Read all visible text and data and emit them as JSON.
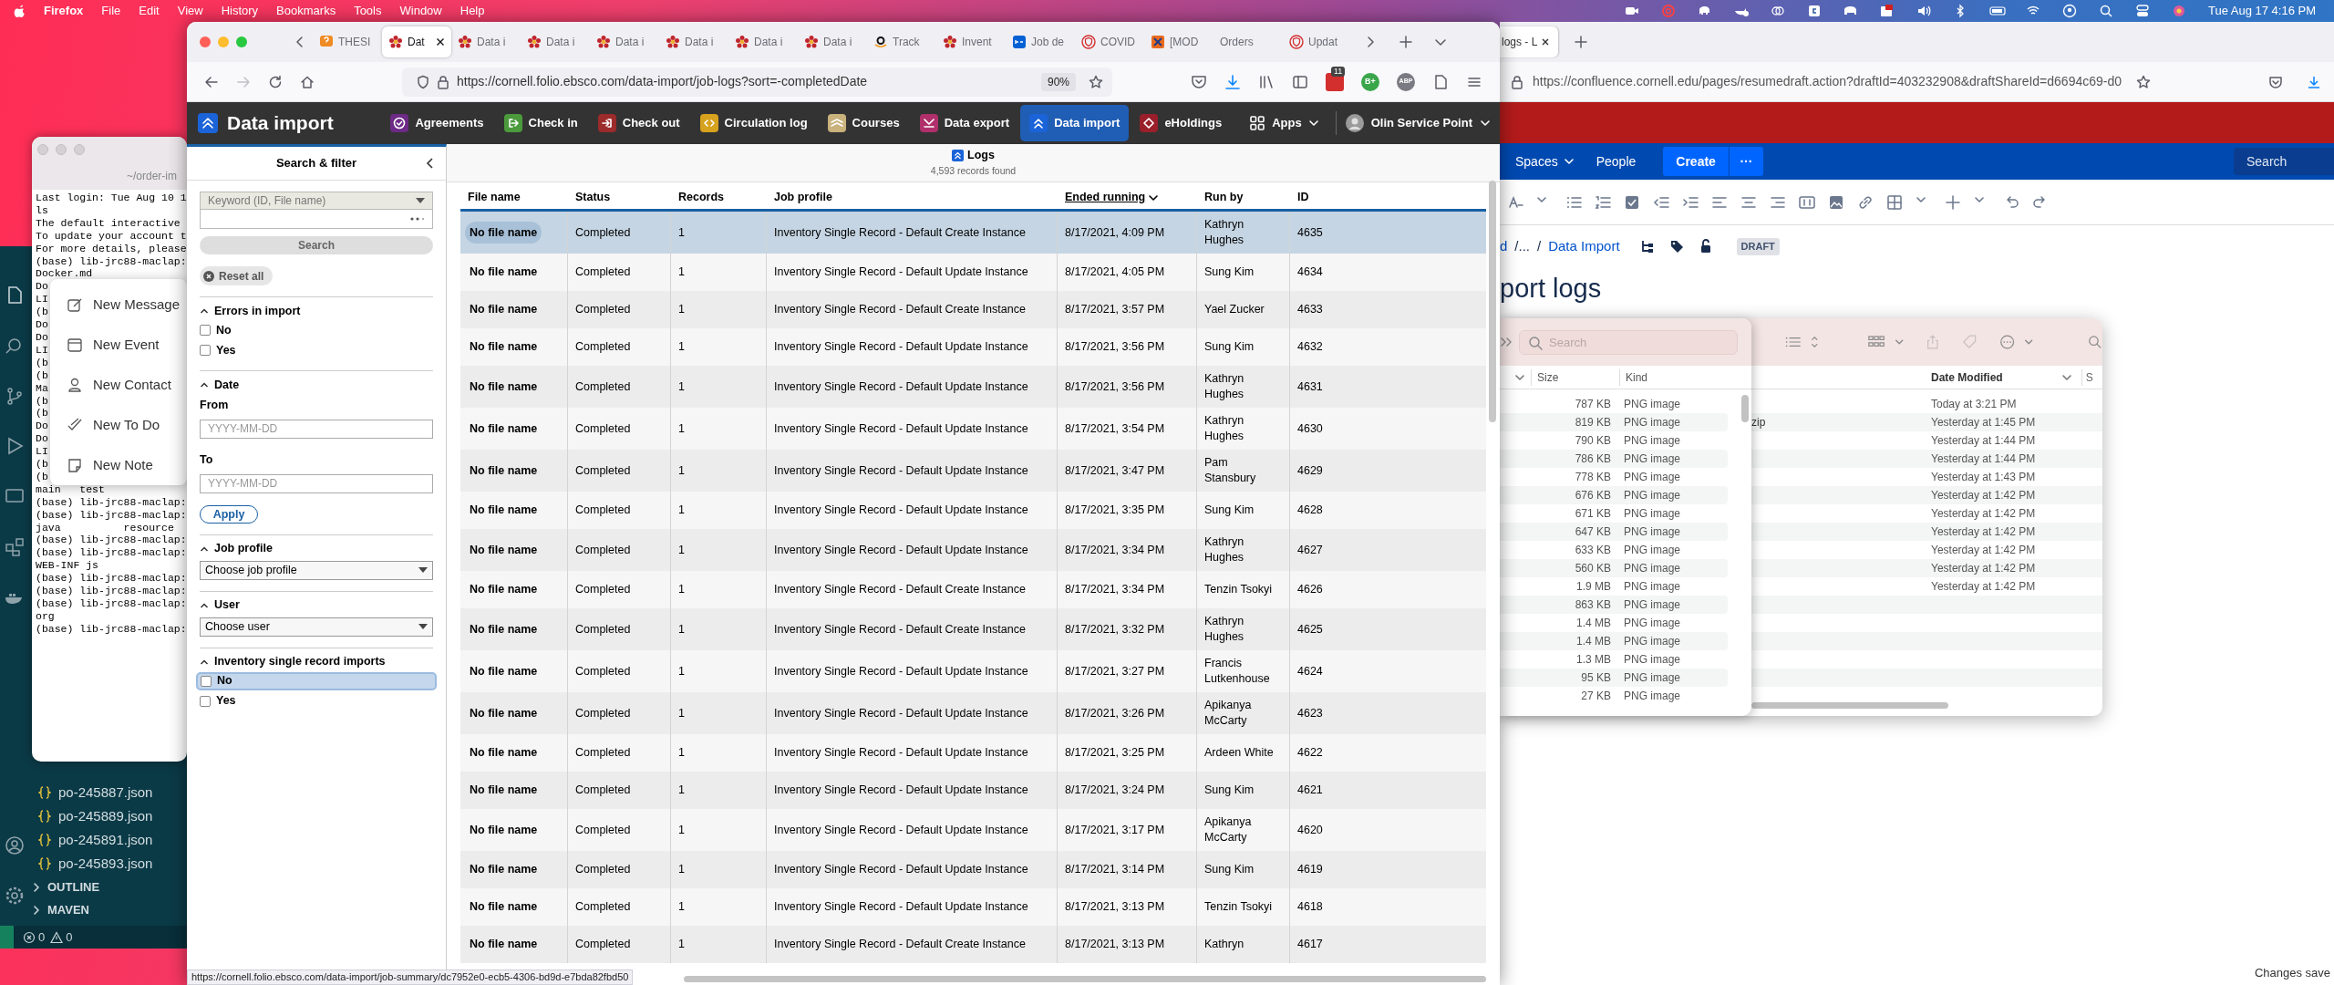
{
  "menu_bar": {
    "menus": [
      "Firefox",
      "File",
      "Edit",
      "View",
      "History",
      "Bookmarks",
      "Tools",
      "Window",
      "Help"
    ],
    "clock": "Tue Aug 17 4:16 PM"
  },
  "vscode": {
    "files": [
      "po-245887.json",
      "po-245889.json",
      "po-245891.json",
      "po-245893.json"
    ],
    "sections": [
      "OUTLINE",
      "MAVEN"
    ],
    "errors": "0",
    "warnings": "0"
  },
  "terminal": {
    "title": "~/order-im",
    "lines": [
      "Last login: Tue Aug 10 1",
      "ls",
      "The default interactive",
      "To update your account t",
      "For more details, please",
      "(base) lib-jrc88-maclap:",
      "Docker.md",
      "Do",
      "LI",
      "(b",
      "Do",
      "Do",
      "LI",
      "(b",
      "(b",
      "Ma",
      "(b",
      "(b",
      "Do",
      "Do",
      "LI",
      "(b",
      "(b",
      "main   test",
      "(base) lib-jrc88-maclap:",
      "(base) lib-jrc88-maclap:",
      "java          resource",
      "(base) lib-jrc88-maclap:",
      "(base) lib-jrc88-maclap:",
      "WEB-INF js",
      "(base) lib-jrc88-maclap:",
      "(base) lib-jrc88-maclap:",
      "(base) lib-jrc88-maclap:",
      "org",
      "(base) lib-jrc88-maclap:"
    ]
  },
  "new_item_menu": {
    "items": [
      {
        "kind": "message",
        "label": "New Message"
      },
      {
        "kind": "event",
        "label": "New Event"
      },
      {
        "kind": "contact",
        "label": "New Contact"
      },
      {
        "kind": "todo",
        "label": "New To Do"
      },
      {
        "kind": "note",
        "label": "New Note"
      }
    ]
  },
  "confluence_window": {
    "tab": "logs - L",
    "url": "https://confluence.cornell.edu/pages/resumedraft.action?draftId=403232908&draftShareId=d6694c69-d0",
    "nav": {
      "spaces": "Spaces",
      "people": "People",
      "create": "Create",
      "more": "···",
      "search_placeholder": "Search"
    },
    "breadcrumb": {
      "start": "d",
      "ellipsis": "/...",
      "separator": "/",
      "link": "Data Import",
      "badge": "DRAFT"
    },
    "title": "port logs",
    "footer": "Changes save"
  },
  "finder": {
    "search_placeholder": "Search",
    "columns": {
      "size": "Size",
      "kind": "Kind",
      "date": "Date Modified",
      "cut": "S"
    },
    "rows": [
      {
        "size": "787 KB",
        "kind": "PNG image",
        "date": "Today at 3:21 PM"
      },
      {
        "size": "819 KB",
        "kind": "PNG image",
        "name": "zip",
        "date": "Yesterday at 1:45 PM"
      },
      {
        "size": "790 KB",
        "kind": "PNG image",
        "date": "Yesterday at 1:44 PM"
      },
      {
        "size": "786 KB",
        "kind": "PNG image",
        "date": "Yesterday at 1:44 PM"
      },
      {
        "size": "778 KB",
        "kind": "PNG image",
        "date": "Yesterday at 1:43 PM"
      },
      {
        "size": "676 KB",
        "kind": "PNG image",
        "date": "Yesterday at 1:42 PM"
      },
      {
        "size": "671 KB",
        "kind": "PNG image",
        "date": "Yesterday at 1:42 PM"
      },
      {
        "size": "647 KB",
        "kind": "PNG image",
        "date": "Yesterday at 1:42 PM"
      },
      {
        "size": "633 KB",
        "kind": "PNG image",
        "date": "Yesterday at 1:42 PM"
      },
      {
        "size": "560 KB",
        "kind": "PNG image",
        "date": "Yesterday at 1:42 PM"
      },
      {
        "size": "1.9 MB",
        "kind": "PNG image",
        "date": "Yesterday at 1:42 PM"
      },
      {
        "size": "863 KB",
        "kind": "PNG image"
      },
      {
        "size": "1.4 MB",
        "kind": "PNG image"
      },
      {
        "size": "1.4 MB",
        "kind": "PNG image"
      },
      {
        "size": "1.3 MB",
        "kind": "PNG image"
      },
      {
        "size": "95 KB",
        "kind": "PNG image"
      },
      {
        "size": "27 KB",
        "kind": "PNG image"
      }
    ]
  },
  "browser": {
    "tabs": [
      {
        "title": "THESI",
        "kind": "question",
        "selected": false
      },
      {
        "title": "Dat",
        "kind": "folio",
        "selected": true
      },
      {
        "title": "Data i",
        "kind": "folio",
        "selected": false
      },
      {
        "title": "Data i",
        "kind": "folio",
        "selected": false
      },
      {
        "title": "Data i",
        "kind": "folio",
        "selected": false
      },
      {
        "title": "Data i",
        "kind": "folio",
        "selected": false
      },
      {
        "title": "Data i",
        "kind": "folio",
        "selected": false
      },
      {
        "title": "Data i",
        "kind": "folio",
        "selected": false
      },
      {
        "title": "Track",
        "kind": "amazon",
        "selected": false
      },
      {
        "title": "Invent",
        "kind": "folio",
        "selected": false
      },
      {
        "title": "Job de",
        "kind": "box",
        "selected": false
      },
      {
        "title": "COVID",
        "kind": "shield",
        "selected": false
      },
      {
        "title": "[MOD",
        "kind": "module",
        "selected": false
      },
      {
        "title": "Orders",
        "kind": "plain",
        "selected": false
      },
      {
        "title": "Updat",
        "kind": "shield",
        "selected": false
      }
    ],
    "forward_disabled": true,
    "url": "https://cornell.folio.ebsco.com/data-import/job-logs?sort=-completedDate",
    "zoom": "90%",
    "extension_badge": "11",
    "grade_extension": "B+",
    "adblock_extension": "ABP"
  },
  "folio": {
    "app_title": "Data import",
    "apps": [
      {
        "label": "Agreements",
        "color": "#6d2a86",
        "selected": false
      },
      {
        "label": "Check in",
        "color": "#4b9a3c",
        "selected": false
      },
      {
        "label": "Check out",
        "color": "#9c2b2b",
        "selected": false
      },
      {
        "label": "Circulation log",
        "color": "#d7a21e",
        "selected": false
      },
      {
        "label": "Courses",
        "color": "#c9b27c",
        "selected": false
      },
      {
        "label": "Data export",
        "color": "#b02f6b",
        "selected": false
      },
      {
        "label": "Data import",
        "color": "#1a63d8",
        "selected": true
      },
      {
        "label": "eHoldings",
        "color": "#9a1f2b",
        "selected": false
      }
    ],
    "apps_menu": "Apps",
    "service_point": "Olin Service Point"
  },
  "filters": {
    "title": "Search & filter",
    "keyword_option": "Keyword (ID, File name)",
    "search_button": "Search",
    "reset_button": "Reset all",
    "sections": [
      {
        "kind": "checkboxes",
        "title": "Errors in import",
        "expanded": true,
        "options": [
          {
            "label": "No",
            "checked": false,
            "focused": false
          },
          {
            "label": "Yes",
            "checked": false,
            "focused": false
          }
        ]
      },
      {
        "kind": "date",
        "title": "Date",
        "expanded": true,
        "from_label": "From",
        "from_placeholder": "YYYY-MM-DD",
        "to_label": "To",
        "to_placeholder": "YYYY-MM-DD",
        "apply": "Apply"
      },
      {
        "kind": "select",
        "title": "Job profile",
        "expanded": true,
        "value": "Choose job profile"
      },
      {
        "kind": "select",
        "title": "User",
        "expanded": true,
        "value": "Choose user"
      },
      {
        "kind": "checkboxes",
        "title": "Inventory single record imports",
        "expanded": true,
        "options": [
          {
            "label": "No",
            "checked": false,
            "focused": true
          },
          {
            "label": "Yes",
            "checked": false,
            "focused": false
          }
        ]
      }
    ]
  },
  "logs": {
    "title": "Logs",
    "count": "4,593 records found",
    "columns": [
      {
        "label": "File name",
        "sorted": false
      },
      {
        "label": "Status",
        "sorted": false
      },
      {
        "label": "Records",
        "sorted": false
      },
      {
        "label": "Job profile",
        "sorted": false
      },
      {
        "label": "Ended running",
        "sorted": true
      },
      {
        "label": "Run by",
        "sorted": false
      },
      {
        "label": "ID",
        "sorted": false
      }
    ],
    "rows": [
      {
        "file": "No file name",
        "status": "Completed",
        "records": "1",
        "profile": "Inventory Single Record - Default Create Instance",
        "ended": "8/17/2021, 4:09 PM",
        "run_by": "Kathryn Hughes",
        "id": "4635",
        "selected": true
      },
      {
        "file": "No file name",
        "status": "Completed",
        "records": "1",
        "profile": "Inventory Single Record - Default Update Instance",
        "ended": "8/17/2021, 4:05 PM",
        "run_by": "Sung Kim",
        "id": "4634",
        "selected": false
      },
      {
        "file": "No file name",
        "status": "Completed",
        "records": "1",
        "profile": "Inventory Single Record - Default Create Instance",
        "ended": "8/17/2021, 3:57 PM",
        "run_by": "Yael Zucker",
        "id": "4633",
        "selected": false
      },
      {
        "file": "No file name",
        "status": "Completed",
        "records": "1",
        "profile": "Inventory Single Record - Default Update Instance",
        "ended": "8/17/2021, 3:56 PM",
        "run_by": "Sung Kim",
        "id": "4632",
        "selected": false
      },
      {
        "file": "No file name",
        "status": "Completed",
        "records": "1",
        "profile": "Inventory Single Record - Default Update Instance",
        "ended": "8/17/2021, 3:56 PM",
        "run_by": "Kathryn Hughes",
        "id": "4631",
        "selected": false
      },
      {
        "file": "No file name",
        "status": "Completed",
        "records": "1",
        "profile": "Inventory Single Record - Default Update Instance",
        "ended": "8/17/2021, 3:54 PM",
        "run_by": "Kathryn Hughes",
        "id": "4630",
        "selected": false
      },
      {
        "file": "No file name",
        "status": "Completed",
        "records": "1",
        "profile": "Inventory Single Record - Default Update Instance",
        "ended": "8/17/2021, 3:47 PM",
        "run_by": "Pam Stansbury",
        "id": "4629",
        "selected": false
      },
      {
        "file": "No file name",
        "status": "Completed",
        "records": "1",
        "profile": "Inventory Single Record - Default Update Instance",
        "ended": "8/17/2021, 3:35 PM",
        "run_by": "Sung Kim",
        "id": "4628",
        "selected": false
      },
      {
        "file": "No file name",
        "status": "Completed",
        "records": "1",
        "profile": "Inventory Single Record - Default Update Instance",
        "ended": "8/17/2021, 3:34 PM",
        "run_by": "Kathryn Hughes",
        "id": "4627",
        "selected": false
      },
      {
        "file": "No file name",
        "status": "Completed",
        "records": "1",
        "profile": "Inventory Single Record - Default Create Instance",
        "ended": "8/17/2021, 3:34 PM",
        "run_by": "Tenzin Tsokyi",
        "id": "4626",
        "selected": false
      },
      {
        "file": "No file name",
        "status": "Completed",
        "records": "1",
        "profile": "Inventory Single Record - Default Create Instance",
        "ended": "8/17/2021, 3:32 PM",
        "run_by": "Kathryn Hughes",
        "id": "4625",
        "selected": false
      },
      {
        "file": "No file name",
        "status": "Completed",
        "records": "1",
        "profile": "Inventory Single Record - Default Update Instance",
        "ended": "8/17/2021, 3:27 PM",
        "run_by": "Francis Lutkenhouse",
        "id": "4624",
        "selected": false
      },
      {
        "file": "No file name",
        "status": "Completed",
        "records": "1",
        "profile": "Inventory Single Record - Default Update Instance",
        "ended": "8/17/2021, 3:26 PM",
        "run_by": "Apikanya McCarty",
        "id": "4623",
        "selected": false
      },
      {
        "file": "No file name",
        "status": "Completed",
        "records": "1",
        "profile": "Inventory Single Record - Default Update Instance",
        "ended": "8/17/2021, 3:25 PM",
        "run_by": "Ardeen White",
        "id": "4622",
        "selected": false
      },
      {
        "file": "No file name",
        "status": "Completed",
        "records": "1",
        "profile": "Inventory Single Record - Default Update Instance",
        "ended": "8/17/2021, 3:24 PM",
        "run_by": "Sung Kim",
        "id": "4621",
        "selected": false
      },
      {
        "file": "No file name",
        "status": "Completed",
        "records": "1",
        "profile": "Inventory Single Record - Default Update Instance",
        "ended": "8/17/2021, 3:17 PM",
        "run_by": "Apikanya McCarty",
        "id": "4620",
        "selected": false
      },
      {
        "file": "No file name",
        "status": "Completed",
        "records": "1",
        "profile": "Inventory Single Record - Default Update Instance",
        "ended": "8/17/2021, 3:14 PM",
        "run_by": "Sung Kim",
        "id": "4619",
        "selected": false
      },
      {
        "file": "No file name",
        "status": "Completed",
        "records": "1",
        "profile": "Inventory Single Record - Default Update Instance",
        "ended": "8/17/2021, 3:13 PM",
        "run_by": "Tenzin Tsokyi",
        "id": "4618",
        "selected": false
      },
      {
        "file": "No file name",
        "status": "Completed",
        "records": "1",
        "profile": "Inventory Single Record - Default Create Instance",
        "ended": "8/17/2021, 3:13 PM",
        "run_by": "Kathryn",
        "id": "4617",
        "selected": false
      }
    ]
  },
  "status_url": "https://cornell.folio.ebsco.com/data-import/job-summary/dc7952e0-ecb5-4306-bd9d-e7bda82fbd50"
}
